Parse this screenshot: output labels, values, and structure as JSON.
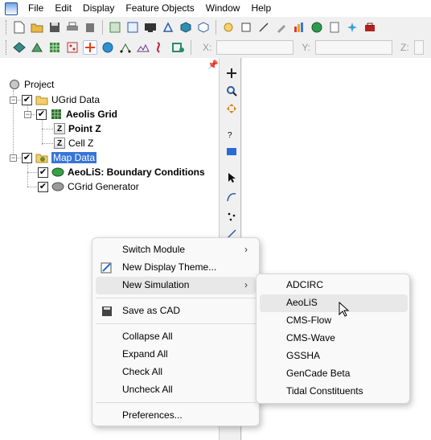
{
  "menubar": {
    "items": [
      "File",
      "Edit",
      "Display",
      "Feature Objects",
      "Window",
      "Help"
    ]
  },
  "coords": {
    "x_label": "X:",
    "y_label": "Y:",
    "z_label": "Z:"
  },
  "tree": {
    "project": "Project",
    "ugrid_data": "UGrid Data",
    "aeolis_grid": "Aeolis Grid",
    "point_z": "Point Z",
    "cell_z": "Cell Z",
    "map_data": "Map Data",
    "aeolis_bc": "AeoLiS: Boundary Conditions",
    "cgrid_generator": "CGrid Generator",
    "z_glyph": "Z"
  },
  "context_menu": {
    "switch_module": "Switch Module",
    "new_display_theme": "New Display Theme...",
    "new_simulation": "New Simulation",
    "save_as_cad": "Save as CAD",
    "collapse_all": "Collapse All",
    "expand_all": "Expand All",
    "check_all": "Check All",
    "uncheck_all": "Uncheck All",
    "preferences": "Preferences..."
  },
  "submenu": {
    "items": [
      "ADCIRC",
      "AeoLiS",
      "CMS-Flow",
      "CMS-Wave",
      "GSSHA",
      "GenCade Beta",
      "Tidal Constituents"
    ],
    "highlighted": "AeoLiS"
  },
  "colors": {
    "selection": "#3875d7",
    "accent": "#2a6ad6"
  }
}
